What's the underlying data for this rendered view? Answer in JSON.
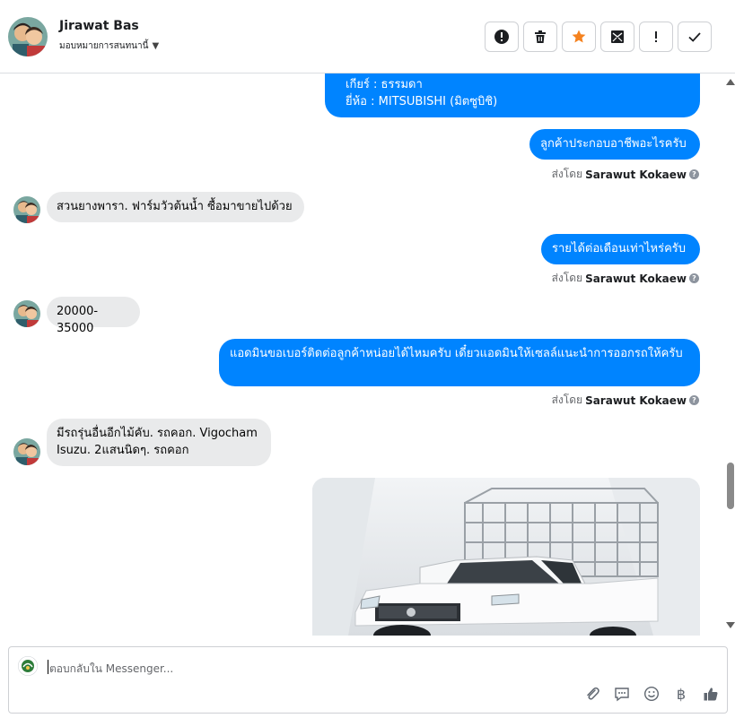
{
  "header": {
    "contact_name": "Jirawat Bas",
    "assign_label": "มอบหมายการสนทนานี้",
    "actions": [
      {
        "name": "mark-spam-button",
        "icon": "alert-circle-icon"
      },
      {
        "name": "delete-button",
        "icon": "trash-icon"
      },
      {
        "name": "star-button",
        "icon": "star-icon"
      },
      {
        "name": "mark-unread-button",
        "icon": "envelope-icon"
      },
      {
        "name": "follow-up-button",
        "icon": "exclamation-icon"
      },
      {
        "name": "mark-done-button",
        "icon": "check-icon"
      }
    ]
  },
  "messages": {
    "m1_line1": "เกียร์ : ธรรมดา",
    "m1_line2": "ยี่ห้อ : MITSUBISHI (มิตซูบิชิ)",
    "m2": "ลูกค้าประกอบอาชีพอะไรครับ",
    "m3": "สวนยางพารา. ฟาร์มวัวต้นน้ำ ซื้อมาขายไปด้วย",
    "m4": "รายได้ต่อเดือนเท่าไหร่ครับ",
    "m5": "20000-35000",
    "m6": "แอดมินขอเบอร์ติดต่อลูกค้าหน่อยได้ไหมครับ เดี๋ยวแอดมินให้เซลล์แนะนำการออกรถให้ครับ",
    "m7": "มีรถรุ่นอื่นอีกไม้คับ. รถคอก. Vigocham Isuzu.  2แสนนิดๆ. รถคอก"
  },
  "sent_by": {
    "prefix": "ส่งโดย",
    "agent": "Sarawut Kokaew",
    "help": "?"
  },
  "composer": {
    "placeholder": "ตอบกลับใน Messenger...",
    "tools": [
      "paperclip-icon",
      "saved-reply-icon",
      "emoji-icon",
      "baht-icon",
      "thumbs-up-icon"
    ],
    "baht_symbol": "฿"
  },
  "colors": {
    "outgoing_bubble": "#0084ff",
    "incoming_bubble": "#e9eaeb",
    "star": "#f5821f"
  }
}
